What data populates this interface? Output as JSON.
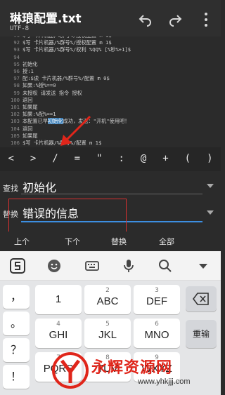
{
  "header": {
    "title": "琳琅配置.txt",
    "encoding": "UTF-8",
    "icons": [
      "undo-icon",
      "redo-icon",
      "more-icon"
    ]
  },
  "editor": {
    "lines": [
      {
        "n": "91",
        "t": "$写 卡片机器/%群号%/授权配置 m 1$"
      },
      {
        "n": "92",
        "t": "$写 卡片机器/%群号%/授权配置 m 1$"
      },
      {
        "n": "93",
        "t": "$写 卡片机器/%群号%/权利 %QQ% [%秒%+1]$"
      },
      {
        "n": "94",
        "t": ""
      },
      {
        "n": "95",
        "t": "初始化"
      },
      {
        "n": "96",
        "t": "授:1"
      },
      {
        "n": "97",
        "t": "配:$读 卡片机器/%群号%/配置 m 0$"
      },
      {
        "n": "98",
        "t": "如果:%授%==0"
      },
      {
        "n": "99",
        "t": "未授权 请发送 指令 授权"
      },
      {
        "n": "100",
        "t": "返回"
      },
      {
        "n": "101",
        "t": "如果尾"
      },
      {
        "n": "102",
        "t": "如果:%配%==1"
      },
      {
        "n": "103",
        "t_before": "本配置已早",
        "t_hl": "初始化",
        "t_after": "成功，发送：\"开机\"使用吧！"
      },
      {
        "n": "104",
        "t": "返回"
      },
      {
        "n": "105",
        "t": "如果尾"
      },
      {
        "n": "106",
        "t": "$写 卡片机器/%群号%/配置 m 1$"
      }
    ]
  },
  "symbols": [
    "<",
    ">",
    "/",
    "=",
    "\"",
    ":",
    "@",
    "+",
    "(",
    ")"
  ],
  "find": {
    "label": "查找",
    "value": "初始化"
  },
  "replace": {
    "label": "替换",
    "value": "错误的信息"
  },
  "actions": {
    "prev": "上个",
    "next": "下个",
    "replace": "替换",
    "all": "全部"
  },
  "keyboard": {
    "toolbar_icons": [
      "sogou-logo-icon",
      "emoji-icon",
      "keyboard-icon",
      "microphone-icon",
      "search-icon",
      "collapse-icon"
    ],
    "side_keys": [
      "，",
      "。",
      "？",
      "！"
    ],
    "keys": [
      {
        "main": "1",
        "sub": ""
      },
      {
        "main": "ABC",
        "sub": "2"
      },
      {
        "main": "DEF",
        "sub": "3"
      },
      {
        "main": "GHI",
        "sub": "4"
      },
      {
        "main": "JKL",
        "sub": "5"
      },
      {
        "main": "MNO",
        "sub": "6"
      },
      {
        "main": "PQRS",
        "sub": "7"
      },
      {
        "main": "TUV",
        "sub": "8"
      },
      {
        "main": "WXYZ",
        "sub": "9"
      }
    ],
    "delete_icon": "backspace-icon",
    "reenter": "重输"
  },
  "watermark": {
    "text": "永辉资源网",
    "url": "www.yhkjjj.com"
  }
}
